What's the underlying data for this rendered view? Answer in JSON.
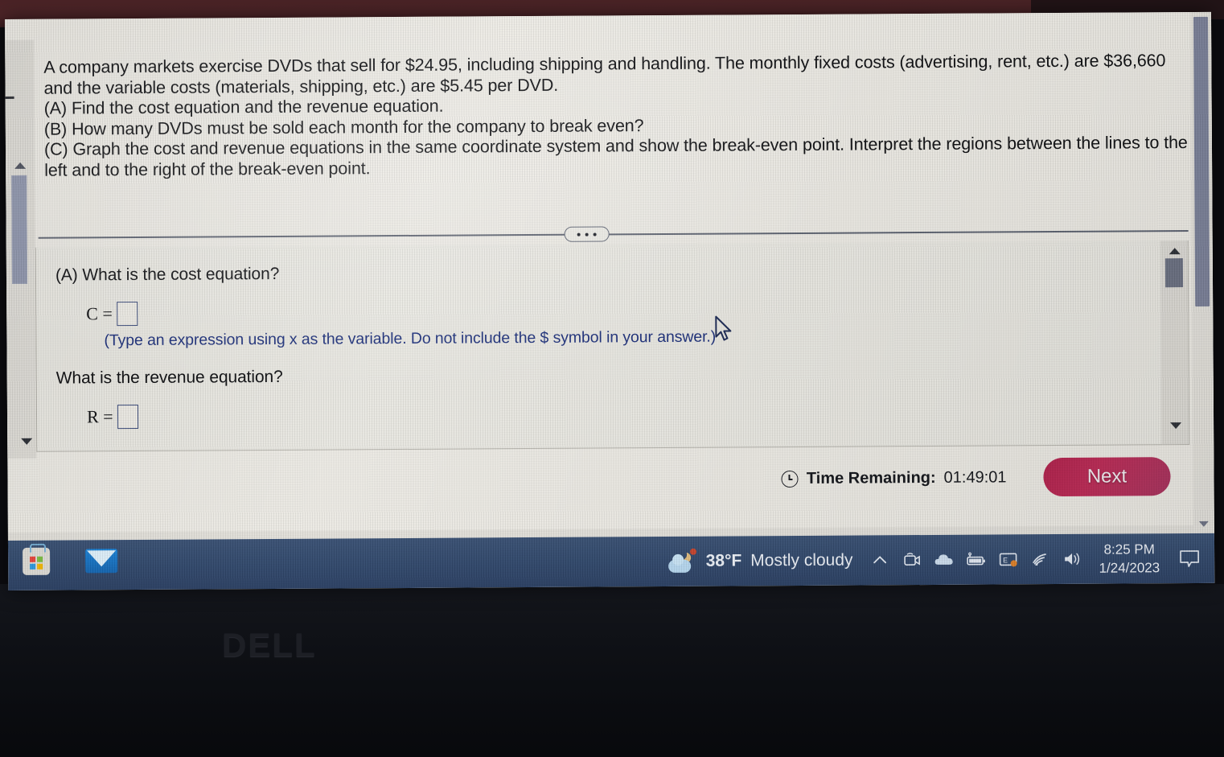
{
  "question": {
    "stem_lines": [
      "A company markets exercise DVDs that sell for $24.95, including shipping and handling. The monthly fixed costs (advertising, rent, etc.) are $36,660",
      "and the variable costs (materials, shipping, etc.) are $5.45 per DVD.",
      "(A) Find the cost equation and the revenue equation.",
      "(B) How many DVDs must be sold each month for the company to break even?",
      "(C) Graph the cost and revenue equations in the same coordinate system and show the break-even point. Interpret the regions between the lines to the",
      "left and to the right of the break-even point."
    ],
    "part_a_prompt": "(A) What is the cost equation?",
    "cost_variable": "C =",
    "cost_answer_value": "",
    "cost_hint": "(Type an expression using x as the variable. Do not include the $ symbol in your answer.)",
    "revenue_prompt": "What is the revenue equation?",
    "revenue_variable": "R =",
    "revenue_answer_value": "",
    "more_options_label": "•••"
  },
  "footer": {
    "timer_icon": "clock-icon",
    "timer_label": "Time Remaining:",
    "timer_value": "01:49:01",
    "next_label": "Next",
    "next_color": "#b1214c"
  },
  "taskbar": {
    "background_color": "#32496c",
    "apps": [
      {
        "name": "microsoft-store",
        "label": "Microsoft Store"
      },
      {
        "name": "mail",
        "label": "Mail"
      }
    ],
    "weather": {
      "temperature": "38°F",
      "condition": "Mostly cloudy",
      "icon": "moon-cloud-icon"
    },
    "tray": [
      {
        "name": "show-hidden-icons",
        "glyph": "chevron-up-icon"
      },
      {
        "name": "webcam-icon"
      },
      {
        "name": "onedrive-icon"
      },
      {
        "name": "battery-icon"
      },
      {
        "name": "display-settings-icon"
      },
      {
        "name": "wifi-icon"
      },
      {
        "name": "volume-icon"
      }
    ],
    "clock": {
      "time": "8:25 PM",
      "date": "1/24/2023"
    },
    "notifications_icon": "chat-bubble-icon"
  },
  "hardware": {
    "brand_logo": "DELL"
  },
  "scrollbars": {
    "left_rail": "question-navigator-scrollbar",
    "answer_panel": "answer-panel-scrollbar",
    "page": "page-scrollbar"
  }
}
